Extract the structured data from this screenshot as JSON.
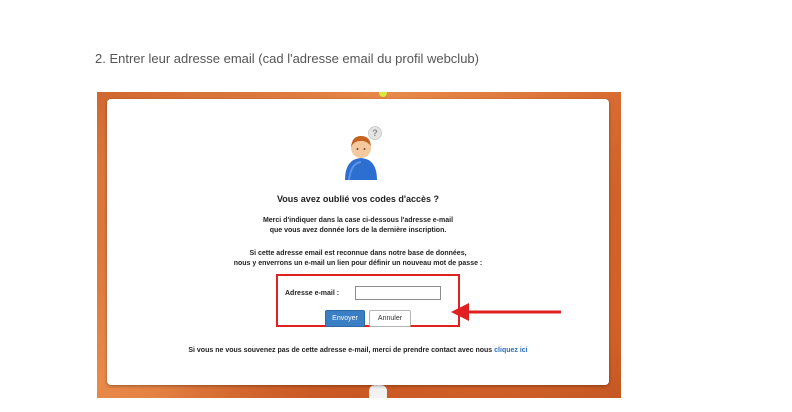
{
  "instruction": {
    "text": "2. Entrer leur adresse email (cad l'adresse email du profil webclub)"
  },
  "dialog": {
    "avatar_icon": "user-question-icon",
    "title": "Vous avez oublié vos codes d'accès ?",
    "paragraph1": {
      "line1": "Merci d'indiquer dans la case ci-dessous l'adresse e-mail",
      "line2": "que vous avez donnée lors de la dernière inscription."
    },
    "paragraph2": {
      "line1": "Si cette adresse email est reconnue dans notre base de données,",
      "line2": "nous y enverrons un e-mail un lien pour définir un nouveau mot de passe :"
    },
    "form": {
      "email_label": "Adresse e-mail :",
      "email_value": "",
      "send_label": "Envoyer",
      "cancel_label": "Annuler"
    },
    "footer": {
      "text": "Si vous ne vous souvenez pas de cette adresse e-mail, merci de prendre contact avec nous",
      "link_label": "cliquez ici"
    }
  },
  "colors": {
    "highlight": "#e02020",
    "send_button": "#3a7fc4",
    "link": "#2a6fc0",
    "background_clay": "#d66a30"
  }
}
